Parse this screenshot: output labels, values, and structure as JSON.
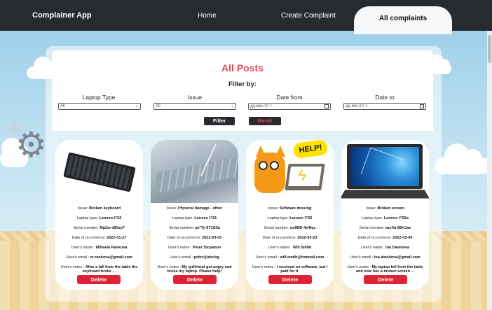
{
  "navbar": {
    "brand": "Complainer App",
    "links": [
      {
        "label": "Home"
      },
      {
        "label": "Create Complaint"
      },
      {
        "label": "All complaints",
        "active": true
      }
    ]
  },
  "page": {
    "title": "All Posts",
    "filter_by": "Filter by:",
    "filters": {
      "laptop_type": {
        "label": "Laptop Type",
        "value": "All"
      },
      "issue": {
        "label": "Issue",
        "value": "All"
      },
      "date_from": {
        "label": "Date from",
        "placeholder": "дд.мм.гггг г."
      },
      "date_to": {
        "label": "Date to",
        "placeholder": "дд.мм.гггг г."
      }
    },
    "buttons": {
      "filter": "Filter",
      "reset": "Reset"
    }
  },
  "labels": {
    "issue": "Issue:",
    "laptop_type": "Laptop type:",
    "serial_number": "Serial number:",
    "date": "Date of occurrence:",
    "user_name": "User's name :",
    "user_email": "User's email :",
    "user_notes": "User's notes :",
    "delete": "Delete"
  },
  "posts": [
    {
      "image": "keyboard-photo",
      "issue": "Broken keyboard",
      "laptop_type": "Lenovo I^52",
      "serial_number": "Mp2er-t80uyl*",
      "date": "2022-01-27",
      "user_name": "Mihaela Rankova",
      "user_email": "m.rankova@gmail.com",
      "user_notes": "After a fall from the table the keyboard broke ..."
    },
    {
      "image": "damaged-laptop-photo",
      "issue": "Physical damage - other",
      "laptop_type": "Lenovo I^51",
      "serial_number": "ae*Ty-971G5a",
      "date": "2022-03-03",
      "user_name": "Peter Stoyanov",
      "user_email": "peter@abv.bg",
      "user_notes": "My girlfriend got angry and broke my laptop. Please help!"
    },
    {
      "image": "help-monster-illustration",
      "issue": "Software missing",
      "laptop_type": "Lenovo I^52",
      "serial_number": "qe9DD-4e4fqz",
      "date": "2022-03-23",
      "user_name": "Will Smith",
      "user_email": "will.smith@hotmail.com",
      "user_notes": "I received no software, but I paid for it."
    },
    {
      "image": "broken-screen-photo",
      "issue": "Broken screen",
      "laptop_type": "Lenovo I^52a",
      "serial_number": "azy4u-89HJae",
      "date": "2022-02-04",
      "user_name": "Ina Davidova",
      "user_email": "ina.davidova@gmail.com",
      "user_notes": "My laptop fell from the table and now has a broken screen ..."
    }
  ]
}
